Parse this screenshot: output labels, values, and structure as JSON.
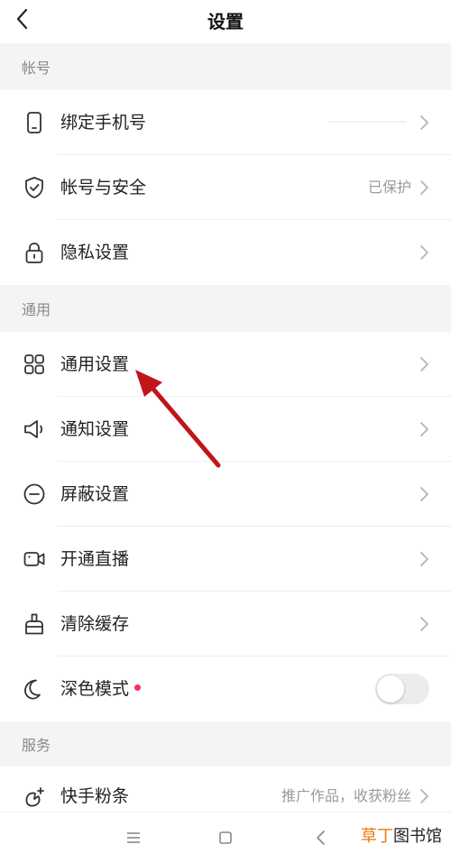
{
  "header": {
    "title": "设置",
    "back_icon": "chevron-left-icon"
  },
  "sections": [
    {
      "title": "帐号"
    },
    {
      "title": "通用"
    },
    {
      "title": "服务"
    }
  ],
  "items": {
    "bind_phone": {
      "label": "绑定手机号",
      "icon": "phone-icon"
    },
    "account_security": {
      "label": "帐号与安全",
      "value": "已保护",
      "icon": "shield-check-icon"
    },
    "privacy": {
      "label": "隐私设置",
      "icon": "lock-icon"
    },
    "general": {
      "label": "通用设置",
      "icon": "grid-icon"
    },
    "notify": {
      "label": "通知设置",
      "icon": "speaker-icon"
    },
    "block": {
      "label": "屏蔽设置",
      "icon": "minus-circle-icon"
    },
    "live": {
      "label": "开通直播",
      "icon": "video-camera-icon"
    },
    "cache": {
      "label": "清除缓存",
      "icon": "brush-icon"
    },
    "dark_mode": {
      "label": "深色模式",
      "icon": "moon-icon",
      "enabled": false,
      "has_dot": true
    },
    "fans": {
      "label": "快手粉条",
      "value": "推广作品，收获粉丝",
      "icon": "rocket-icon"
    }
  },
  "navbar": {
    "menu_icon": "menu-icon",
    "home_icon": "square-icon",
    "back_icon": "back-triangle-icon"
  },
  "watermark": {
    "part1": "草丁",
    "part2": "图书馆"
  },
  "colors": {
    "accent_dot": "#ff2e58",
    "section_bg": "#f4f4f4",
    "arrow": "#c0151b"
  }
}
